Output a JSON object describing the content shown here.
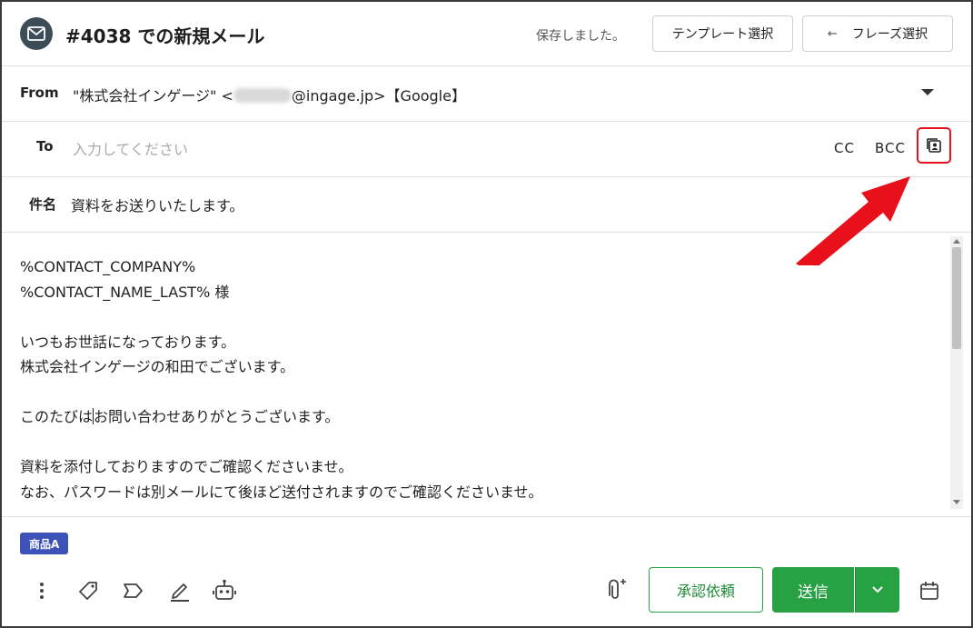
{
  "header": {
    "title": "#4038 での新規メール",
    "status": "保存しました。",
    "template_button": "テンプレート選択",
    "phrase_button": "フレーズ選択"
  },
  "from": {
    "label": "From",
    "value_prefix": "\"株式会社インゲージ\" <",
    "value_suffix": "@ingage.jp>【Google】"
  },
  "to": {
    "label": "To",
    "placeholder": "入力してください",
    "cc": "CC",
    "bcc": "BCC"
  },
  "subject": {
    "label": "件名",
    "value": "資料をお送りいたします。"
  },
  "body": {
    "line1": "%CONTACT_COMPANY%",
    "line2": "%CONTACT_NAME_LAST% 様",
    "line3": "いつもお世話になっております。",
    "line4": "株式会社インゲージの和田でございます。",
    "line5a": "このたびは",
    "line5b": "お問い合わせありがとうございます。",
    "line6": "資料を添付しておりますのでご確認くださいませ。",
    "line7": "なお、パスワードは別メールにて後ほど送付されますのでご確認くださいませ。"
  },
  "tag": "商品A",
  "footer": {
    "approve_button": "承認依頼",
    "send_button": "送信"
  },
  "colors": {
    "accent_green": "#27a144",
    "tag_blue": "#3d52b6",
    "highlight_red": "#e8101a"
  }
}
